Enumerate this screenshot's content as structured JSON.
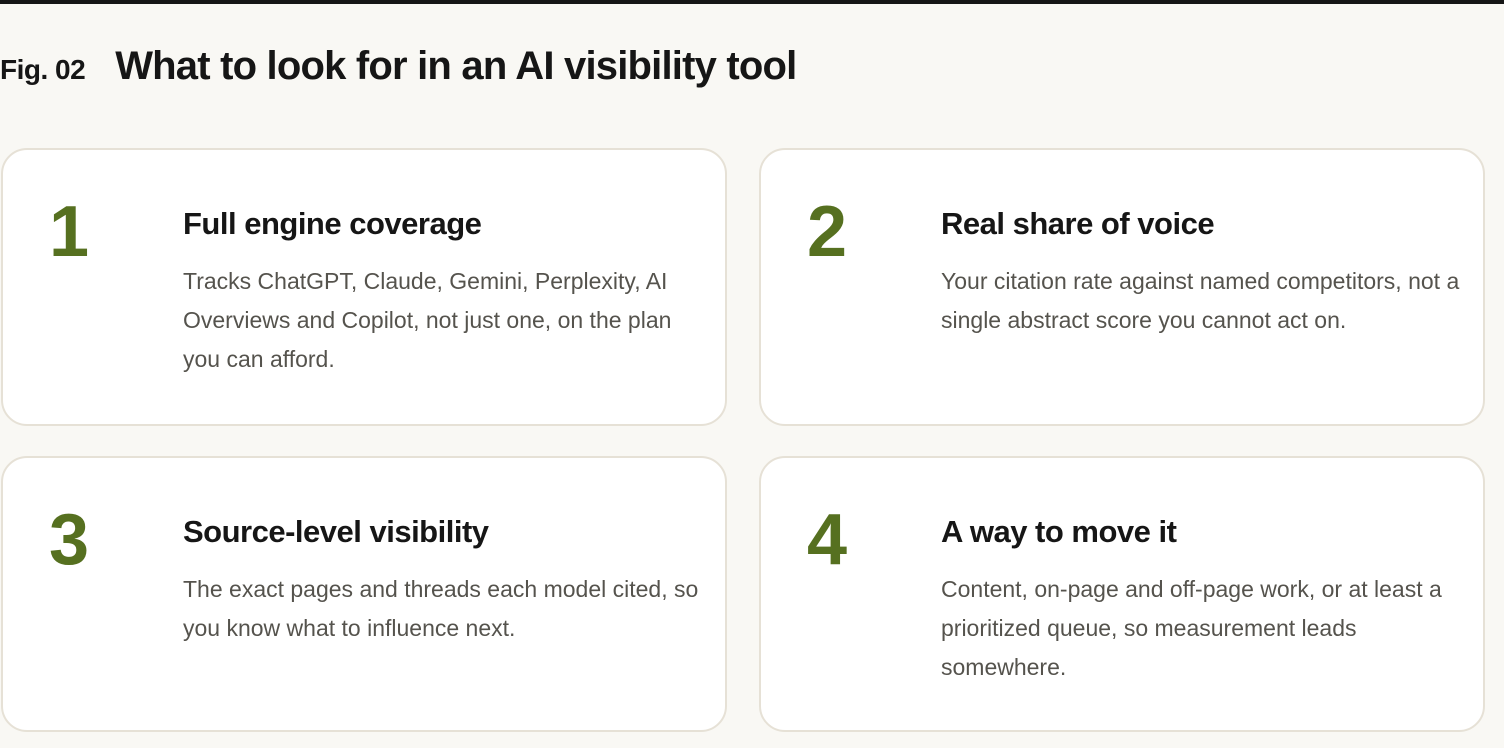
{
  "header": {
    "fig_label": "Fig. 02",
    "title": "What to look for in an AI visibility tool"
  },
  "cards": [
    {
      "number": "1",
      "heading": "Full engine coverage",
      "body": "Tracks ChatGPT, Claude, Gemini, Perplexity, AI Overviews and Copilot, not just one, on the plan you can afford."
    },
    {
      "number": "2",
      "heading": "Real share of voice",
      "body": "Your citation rate against named competitors, not a single abstract score you cannot act on."
    },
    {
      "number": "3",
      "heading": "Source-level visibility",
      "body": "The exact pages and threads each model cited, so you know what to influence next."
    },
    {
      "number": "4",
      "heading": "A way to move it",
      "body": "Content, on-page and off-page work, or at least a prioritized queue, so measurement leads somewhere."
    }
  ],
  "colors": {
    "accent": "#567020",
    "background": "#f9f8f4",
    "card_background": "#ffffff",
    "card_border": "#e6e1d6",
    "text": "#161616",
    "body_text": "#55534d"
  }
}
